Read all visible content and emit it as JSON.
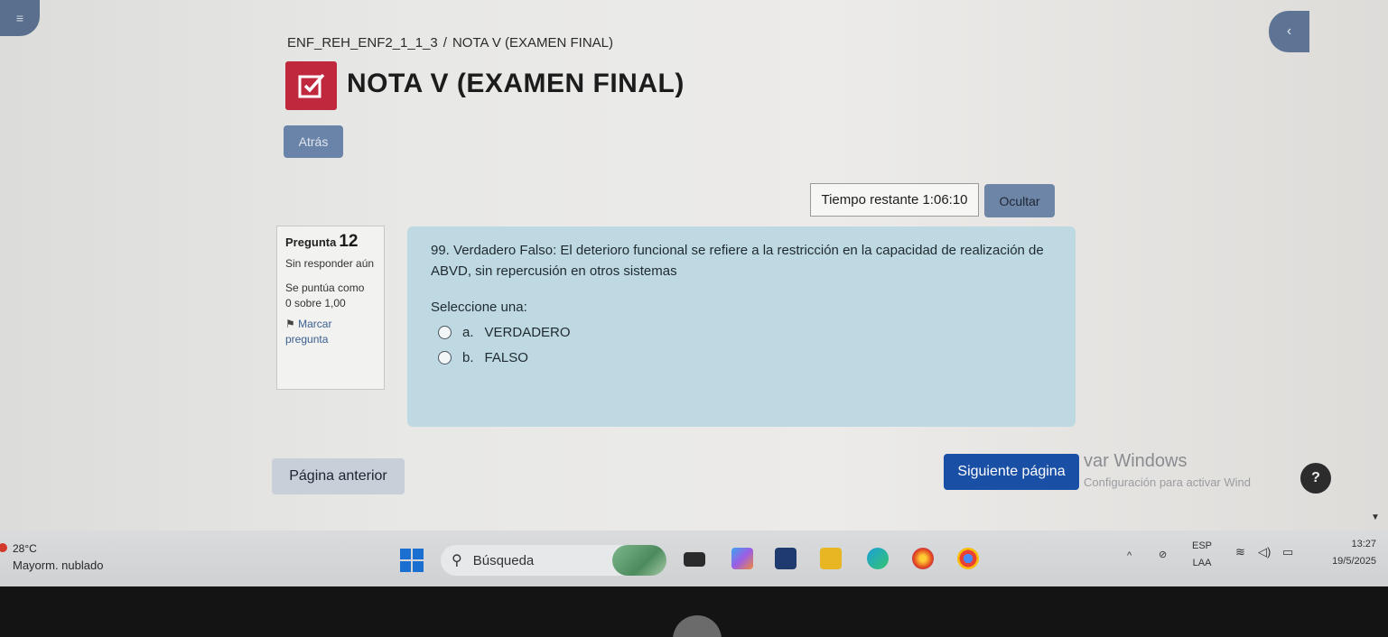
{
  "breadcrumb": {
    "course": "ENF_REH_ENF2_1_1_3",
    "separator": "/",
    "current": "NOTA V (EXAMEN FINAL)"
  },
  "header": {
    "title": "NOTA V (EXAMEN FINAL)",
    "icon": "quiz-checkbox-icon",
    "back_label": "Atrás"
  },
  "timer": {
    "label": "Tiempo restante",
    "value": "1:06:10",
    "hide_label": "Ocultar"
  },
  "question_info": {
    "label": "Pregunta",
    "number": "12",
    "status": "Sin responder aún",
    "score_label": "Se puntúa como",
    "score_value": "0 sobre 1,00",
    "flag_label": "Marcar pregunta"
  },
  "question": {
    "text": "99. Verdadero Falso: El deterioro funcional se refiere a la restricción en la capacidad de realización de ABVD, sin repercusión en otros sistemas",
    "prompt": "Seleccione una:",
    "options": [
      {
        "letter": "a.",
        "label": "VERDADERO"
      },
      {
        "letter": "b.",
        "label": "FALSO"
      }
    ]
  },
  "navigation": {
    "prev_label": "Página anterior",
    "next_label": "Siguiente página"
  },
  "watermark": {
    "line1": "var Windows",
    "line2": "Configuración para activar Wind"
  },
  "help_label": "?",
  "taskbar": {
    "weather_temp": "28°C",
    "weather_desc": "Mayorm. nublado",
    "search_placeholder": "Búsqueda",
    "lang_top": "ESP",
    "lang_bottom": "LAA",
    "time": "13:27",
    "date": "19/5/2025"
  },
  "colors": {
    "title_icon": "#c0283d",
    "next_button": "#1a4fa6",
    "question_bg": "#bfd9e2"
  }
}
